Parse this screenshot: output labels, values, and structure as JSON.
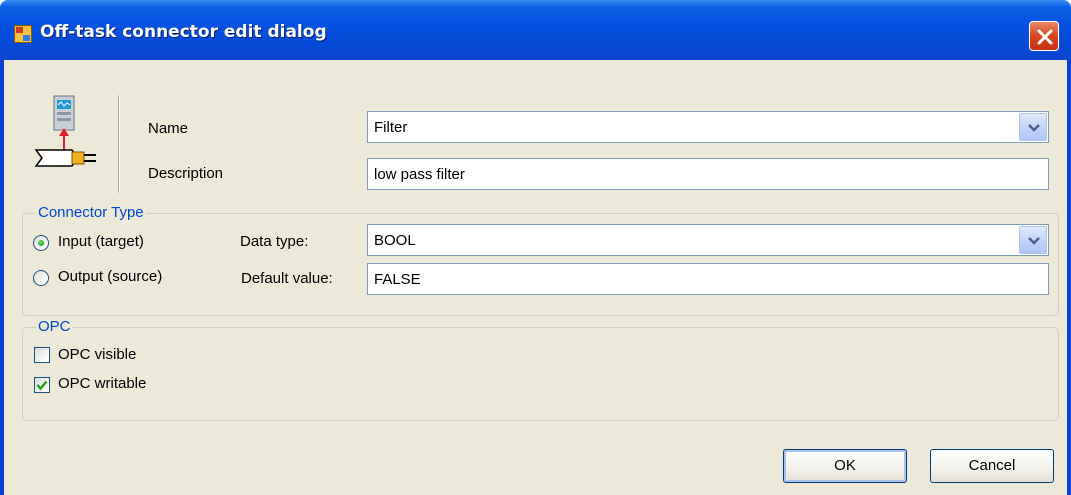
{
  "window": {
    "title": "Off-task connector edit dialog"
  },
  "general": {
    "name_label": "Name",
    "name_value": "Filter",
    "description_label": "Description",
    "description_value": "low pass filter"
  },
  "connector_type": {
    "group_label": "Connector Type",
    "input_label": "Input (target)",
    "output_label": "Output (source)",
    "selected": "input",
    "data_type_label": "Data type:",
    "data_type_value": "BOOL",
    "default_value_label": "Default value:",
    "default_value_value": "FALSE"
  },
  "opc": {
    "group_label": "OPC",
    "visible_label": "OPC visible",
    "visible_checked": false,
    "writable_label": "OPC writable",
    "writable_checked": true
  },
  "buttons": {
    "ok": "OK",
    "cancel": "Cancel"
  },
  "colors": {
    "titlebar": "#0553e0",
    "dialog_bg": "#ece9d8",
    "group_label": "#0046d5",
    "close_button": "#d9451c"
  },
  "icons": {
    "title": "app-window-icon",
    "dialog": "connector-icon",
    "close": "close-icon"
  }
}
